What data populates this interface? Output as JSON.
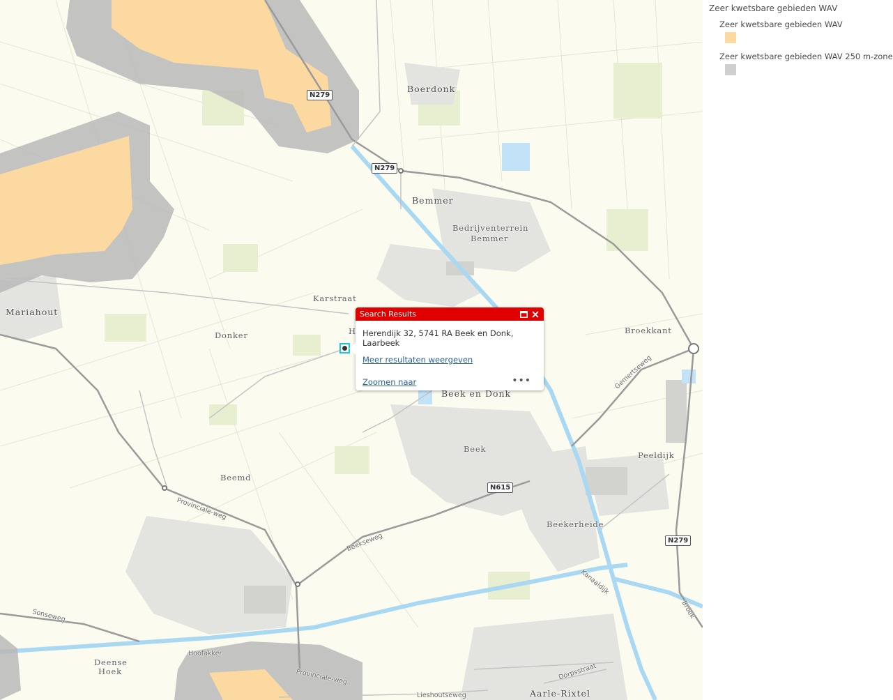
{
  "legend": {
    "title": "Zeer kwetsbare gebieden WAV",
    "items": [
      {
        "label": "Zeer kwetsbare gebieden WAV",
        "color": "#fcd9a1"
      },
      {
        "label": "Zeer kwetsbare gebieden WAV 250 m-zone",
        "color": "#cfcfcf"
      }
    ]
  },
  "places": {
    "boerdonk": "Boerdonk",
    "bemmer": "Bemmer",
    "bedrijventerrein1": "Bedrijventerrein",
    "bedrijventerrein2": "Bemmer",
    "mariahout": "Mariahout",
    "karstraat": "Karstraat",
    "donker": "Donker",
    "broekkant": "Broekkant",
    "beek_en_donk": "Beek en Donk",
    "beek": "Beek",
    "peeldijk": "Peeldijk",
    "beemd": "Beemd",
    "beekerheide": "Beekerheide",
    "deense": "Deense",
    "hoek": "Hoek",
    "aarle_rixtel": "Aarle-Rixtel",
    "partial_h": "H"
  },
  "roads": {
    "n279_a": "N279",
    "n279_b": "N279",
    "n279_c": "N279",
    "n615": "N615"
  },
  "streets": {
    "gemertseweg": "Gemertseweg",
    "provinciale_weg": "Provinciale-weg",
    "beekseweg": "Beekseweg",
    "kanaaldijk": "Kanaaldijk",
    "sonseweg": "Sonseweg",
    "hoofakker": "Hoofakker",
    "dorpsstraat": "Dorpsstraat",
    "lieshoutseweg": "Lieshoutseweg",
    "provinciale_weg_2": "Provinciale-weg",
    "broek": "Broek"
  },
  "popup": {
    "title": "Search Results",
    "address": "Herendijk 32, 5741 RA Beek en Donk, Laarbeek",
    "more_results": "Meer resultaten weergeven",
    "zoom_to": "Zoomen naar",
    "maximize_icon": "maximize-icon",
    "close_icon": "close-icon",
    "more_icon": "more-icon",
    "header_color": "#e00000"
  }
}
